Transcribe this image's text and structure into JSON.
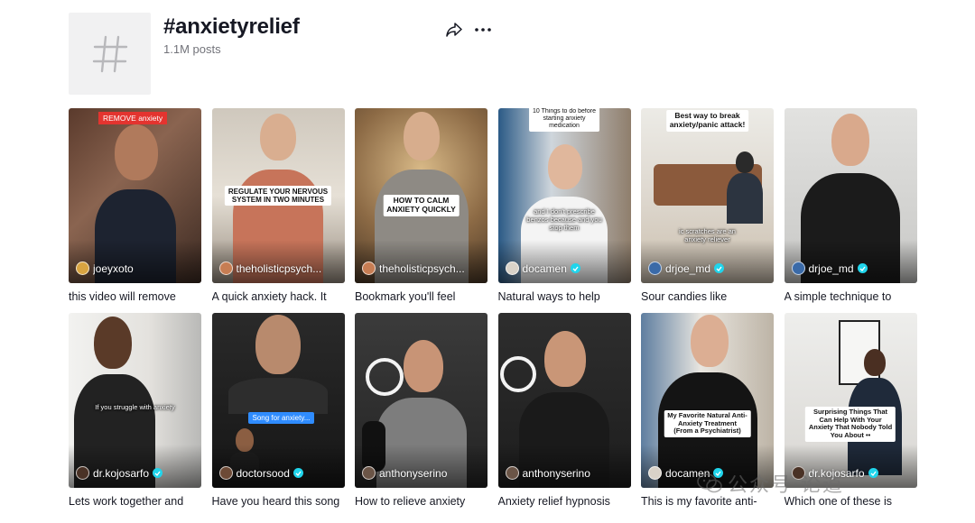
{
  "hashtag": {
    "title": "#anxietyrelief",
    "post_count": "1.1M posts",
    "icons": {
      "avatar": "hashtag-icon",
      "share": "share-arrow-icon",
      "more": "more-dots-icon"
    }
  },
  "colors": {
    "verified": "#20d5ec",
    "red_banner": "#e3342f",
    "blue_banner": "#2f8cff",
    "text": "#161823",
    "muted": "#72737a"
  },
  "videos": [
    {
      "author": "joeyxoto",
      "verified": false,
      "description": "this video will remove",
      "banner": "REMOVE anxiety",
      "overlay": ""
    },
    {
      "author": "theholisticpsych...",
      "verified": false,
      "description": "A quick anxiety hack. It",
      "caption": "REGULATE YOUR NERVOUS\nSYSTEM IN TWO MINUTES",
      "overlay": ""
    },
    {
      "author": "theholisticpsych...",
      "verified": false,
      "description": "Bookmark you'll feel",
      "caption": "HOW TO CALM\nANXIETY QUICKLY",
      "overlay": ""
    },
    {
      "author": "docamen",
      "verified": true,
      "description": "Natural ways to help",
      "caption": "10 Things to do before\nstarting anxiety\nmedication",
      "overlay": "and I don't prescribe\nbenzos because and you\nstop them"
    },
    {
      "author": "drjoe_md",
      "verified": true,
      "description": "Sour candies like",
      "caption": "Best way to break\nanxiety/panic attack!",
      "overlay": "ic scratches are an\nanxiety reliever"
    },
    {
      "author": "drjoe_md",
      "verified": true,
      "description": "A simple technique to",
      "caption": "",
      "overlay": ""
    },
    {
      "author": "dr.kojosarfo",
      "verified": true,
      "description": "Lets work together and",
      "caption": "",
      "overlay": "If you struggle with anxiety"
    },
    {
      "author": "doctorsood",
      "verified": true,
      "description": "Have you heard this song",
      "caption": "",
      "overlay": "",
      "blue_banner": "Song for anxiety..."
    },
    {
      "author": "anthonyserino",
      "verified": false,
      "description": "How to relieve anxiety",
      "caption": "",
      "overlay": ""
    },
    {
      "author": "anthonyserino",
      "verified": false,
      "description": "Anxiety relief hypnosis",
      "caption": "",
      "overlay": ""
    },
    {
      "author": "docamen",
      "verified": true,
      "description": "This is my favorite anti-",
      "caption": "My Favorite Natural Anti-\nAnxiety Treatment\n(From a Psychiatrist)",
      "overlay": ""
    },
    {
      "author": "dr.kojosarfo",
      "verified": true,
      "description": "Which one of these is",
      "caption": "Surprising Things That\nCan Help With Your\nAnxiety That Nobody Told\nYou About ••",
      "overlay": ""
    }
  ],
  "watermark": {
    "text": "公众号·论道",
    "icon": "wechat-logo-icon"
  }
}
